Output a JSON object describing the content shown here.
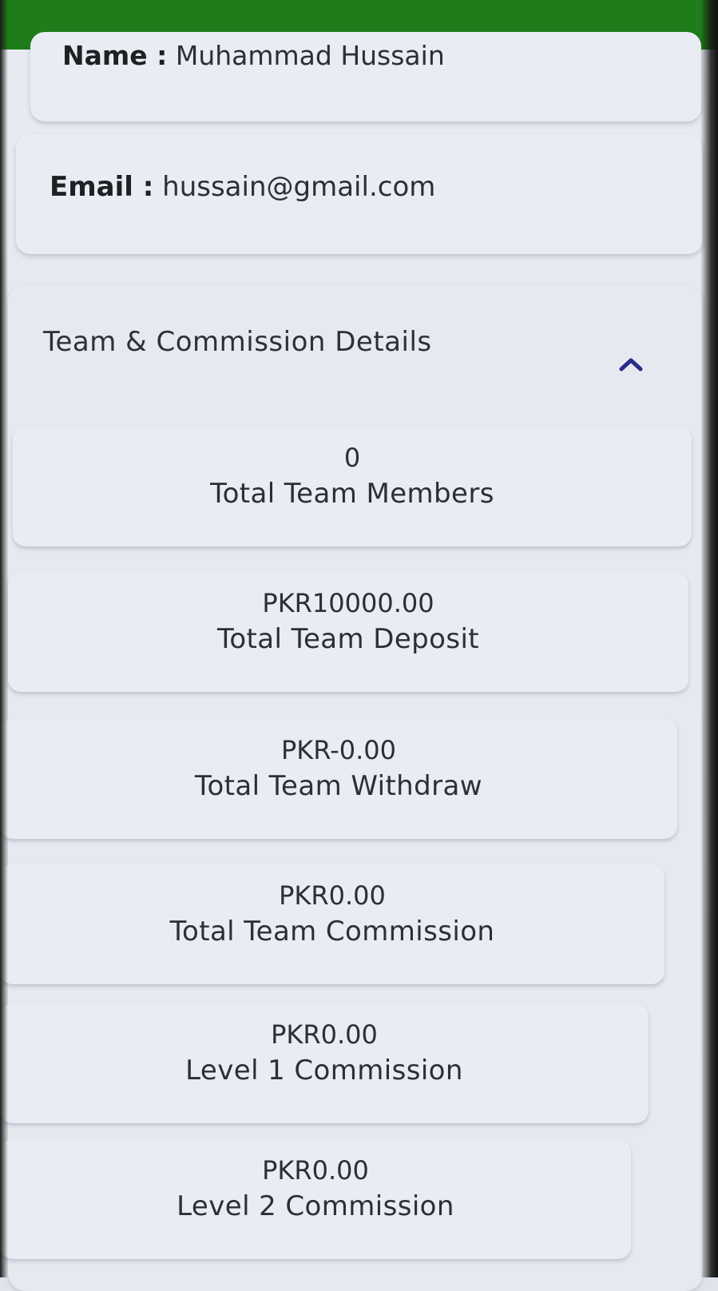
{
  "profile": {
    "name_label": "Name :",
    "name_value": "Muhammad Hussain",
    "email_label": "Email :",
    "email_value": "hussain@gmail.com"
  },
  "team_section": {
    "title": "Team & Commission Details",
    "expanded": true,
    "toggle_icon": "chevron-up-icon",
    "stats": [
      {
        "value": "0",
        "label": "Total Team Members"
      },
      {
        "value": "PKR10000.00",
        "label": "Total Team Deposit"
      },
      {
        "value": "PKR-0.00",
        "label": "Total Team Withdraw"
      },
      {
        "value": "PKR0.00",
        "label": "Total Team Commission"
      },
      {
        "value": "PKR0.00",
        "label": "Level 1 Commission"
      },
      {
        "value": "PKR0.00",
        "label": "Level 2 Commission"
      }
    ]
  },
  "colors": {
    "header_green": "#1e7d1a",
    "card_background": "#e9ecf2",
    "chevron": "#2a2a8c"
  }
}
